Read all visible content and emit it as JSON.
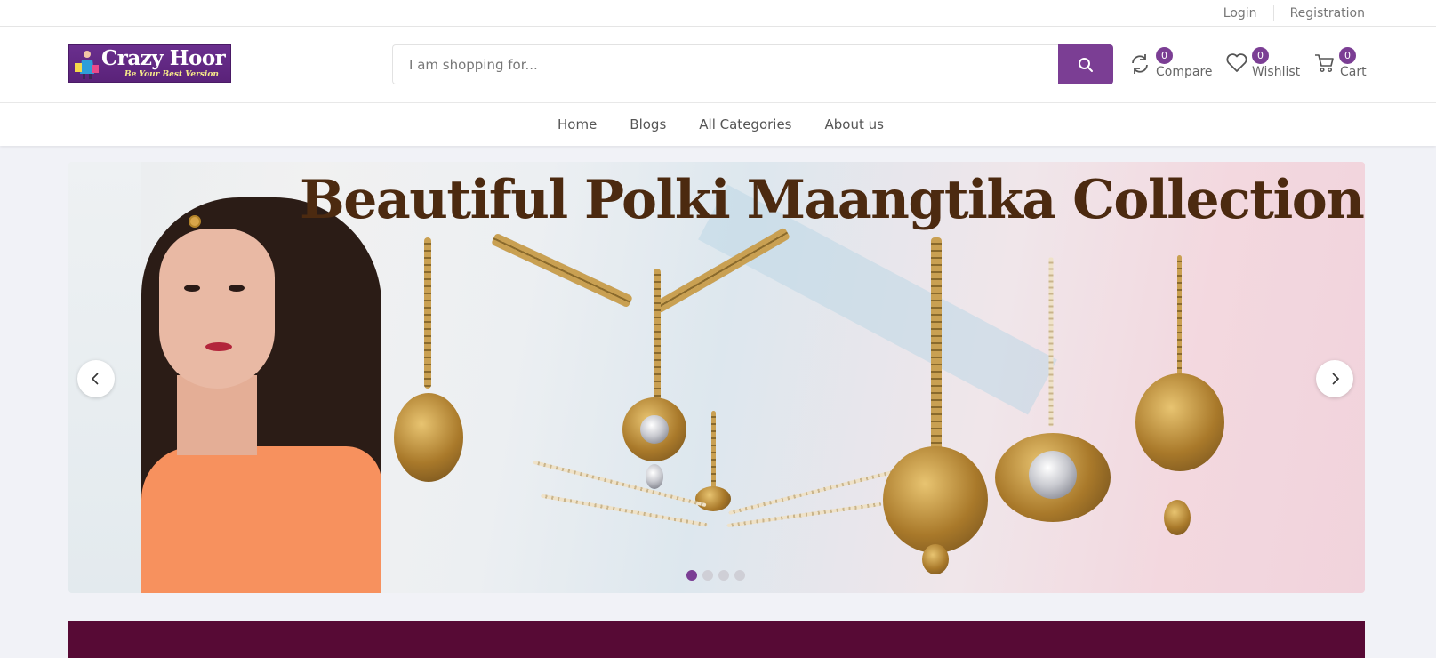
{
  "topbar": {
    "login": "Login",
    "registration": "Registration"
  },
  "logo": {
    "name": "Crazy Hoor",
    "tagline": "Be Your Best Version"
  },
  "search": {
    "placeholder": "I am shopping for..."
  },
  "header_icons": [
    {
      "icon": "compare-icon",
      "label": "Compare",
      "count": "0"
    },
    {
      "icon": "heart-icon",
      "label": "Wishlist",
      "count": "0"
    },
    {
      "icon": "cart-icon",
      "label": "Cart",
      "count": "0"
    }
  ],
  "nav": {
    "items": [
      "Home",
      "Blogs",
      "All Categories",
      "About us"
    ]
  },
  "hero": {
    "headline": "Beautiful Polki Maangtika Collection",
    "slide_count": 4,
    "active_slide": 1
  },
  "colors": {
    "accent": "#7b3e94",
    "headline": "#4c2a10",
    "banner": "#570a35",
    "background": "#f1f2f7"
  }
}
